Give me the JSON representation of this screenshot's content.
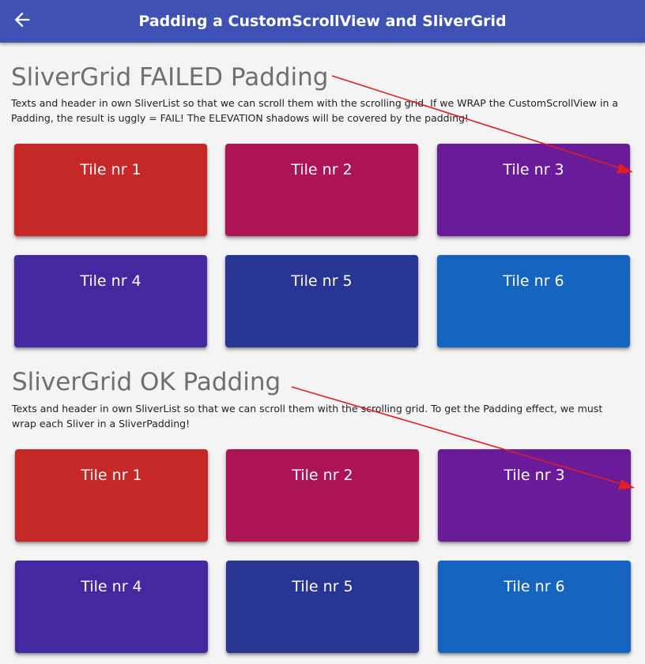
{
  "appbar": {
    "title": "Padding a CustomScrollView and SliverGrid",
    "color": "#3f51b5",
    "back_icon": "arrow-back-icon"
  },
  "sections": [
    {
      "heading": "SliverGrid FAILED Padding",
      "description": "Texts and header in own SliverList so that we can scroll them with the scrolling grid. If we WRAP the CustomScrollView in a Padding, the result is uggly = FAIL! The ELEVATION shadows will be covered by the padding!",
      "tiles": [
        {
          "label": "Tile nr 1",
          "color": "#c62828"
        },
        {
          "label": "Tile nr 2",
          "color": "#ad1457"
        },
        {
          "label": "Tile nr 3",
          "color": "#6a1b9a"
        },
        {
          "label": "Tile nr 4",
          "color": "#4527a0"
        },
        {
          "label": "Tile nr 5",
          "color": "#283593"
        },
        {
          "label": "Tile nr 6",
          "color": "#1565c0"
        }
      ]
    },
    {
      "heading": "SliverGrid OK Padding",
      "description": "Texts and header in own SliverList so that we can scroll them with the scrolling grid. To get the Padding effect, we must wrap each Sliver in a SliverPadding!",
      "tiles": [
        {
          "label": "Tile nr 1",
          "color": "#c62828"
        },
        {
          "label": "Tile nr 2",
          "color": "#ad1457"
        },
        {
          "label": "Tile nr 3",
          "color": "#6a1b9a"
        },
        {
          "label": "Tile nr 4",
          "color": "#4527a0"
        },
        {
          "label": "Tile nr 5",
          "color": "#283593"
        },
        {
          "label": "Tile nr 6",
          "color": "#1565c0"
        }
      ]
    }
  ],
  "annotation_color": "#e02020"
}
